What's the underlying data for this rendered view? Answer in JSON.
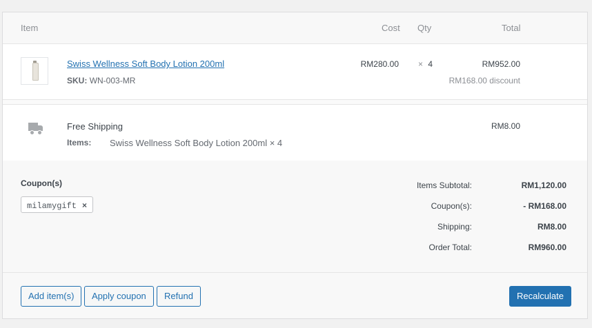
{
  "header": {
    "item": "Item",
    "cost": "Cost",
    "qty": "Qty",
    "total": "Total"
  },
  "line_item": {
    "thumbnail_icon": "lotion-tube-thumbnail",
    "name": "Swiss Wellness Soft Body Lotion 200ml",
    "sku_label": "SKU:",
    "sku_value": "WN-003-MR",
    "cost": "RM280.00",
    "qty_prefix": "×",
    "qty": "4",
    "total": "RM952.00",
    "discount": "RM168.00 discount"
  },
  "shipping": {
    "icon": "truck-icon",
    "method": "Free Shipping",
    "items_label": "Items:",
    "items_value": "Swiss Wellness Soft Body Lotion 200ml × 4",
    "total": "RM8.00"
  },
  "coupons": {
    "label": "Coupon(s)",
    "codes": [
      "milamygift"
    ],
    "remove_glyph": "×"
  },
  "totals": {
    "subtotal_label": "Items Subtotal:",
    "subtotal_value": "RM1,120.00",
    "coupon_label": "Coupon(s):",
    "coupon_value": "- RM168.00",
    "shipping_label": "Shipping:",
    "shipping_value": "RM8.00",
    "order_label": "Order Total:",
    "order_value": "RM960.00"
  },
  "actions": {
    "add_items": "Add item(s)",
    "apply_coupon": "Apply coupon",
    "refund": "Refund",
    "recalculate": "Recalculate"
  },
  "colors": {
    "accent": "#2271b1",
    "border": "#dcdcde",
    "muted": "#8c8f94"
  }
}
